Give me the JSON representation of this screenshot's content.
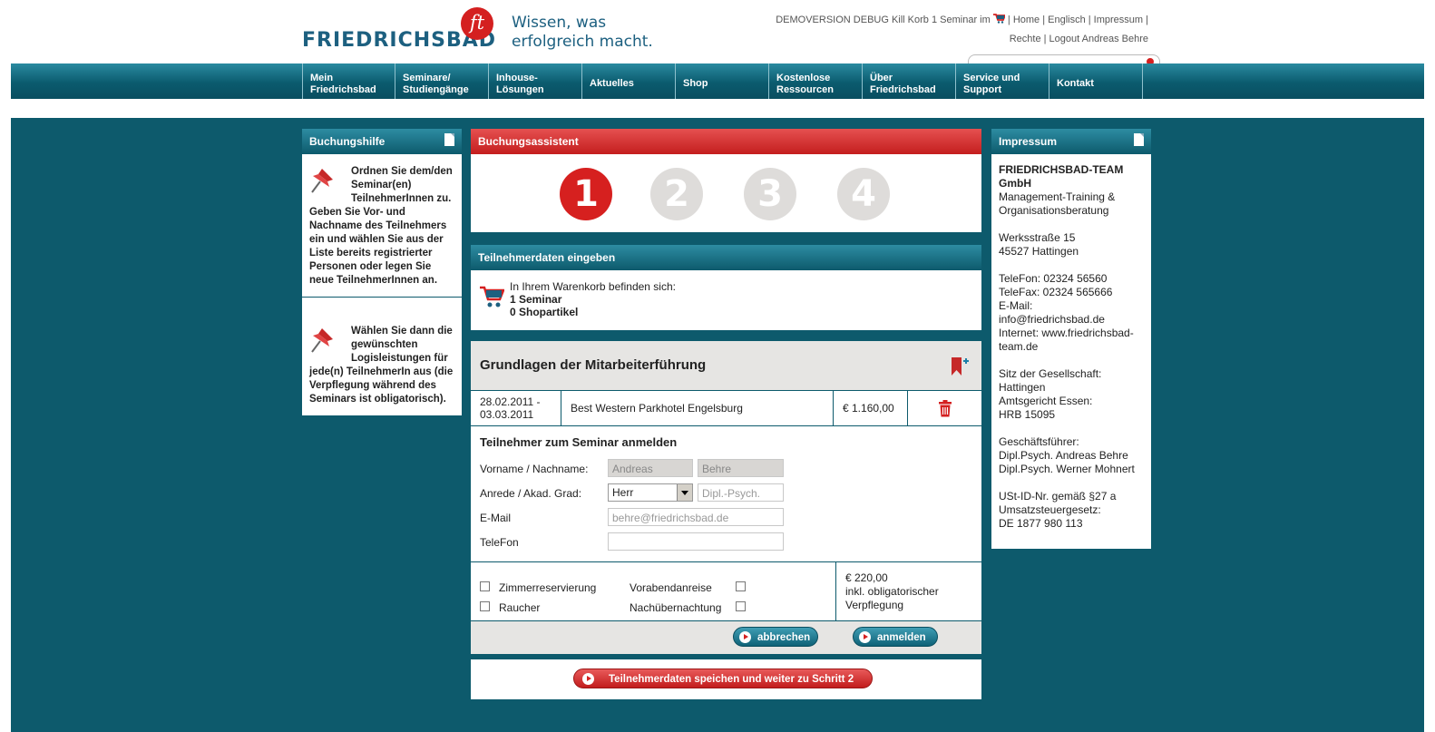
{
  "header": {
    "logo_text": "FRIEDRICHSBAD",
    "logo_mark": "ft",
    "slogan_line1": "Wissen, was",
    "slogan_line2": "erfolgreich macht.",
    "toplinks_line1_a": "DEMOVERSION DEBUG Kill Korb 1 Seminar im",
    "toplinks_line1_b": "| Home | Englisch | Impressum |",
    "toplinks_line2": "Rechte | Logout Andreas Behre",
    "cart_icon": "cart-icon"
  },
  "nav": {
    "items": [
      {
        "label": "Mein Friedrichsbad"
      },
      {
        "label": "Seminare/ Studiengänge"
      },
      {
        "label": "Inhouse-Lösungen"
      },
      {
        "label": "Aktuelles"
      },
      {
        "label": "Shop"
      },
      {
        "label": "Kostenlose Ressourcen"
      },
      {
        "label": "Über Friedrichsbad"
      },
      {
        "label": "Service und Support"
      },
      {
        "label": "Kontakt"
      }
    ]
  },
  "left": {
    "title": "Buchungshilfe",
    "help1": "Ordnen Sie dem/den Seminar(en) TeilnehmerInnen zu. Geben Sie Vor- und Nachname des Teilnehmers ein und wählen Sie aus der Liste bereits registrierter Personen oder legen Sie neue TeilnehmerInnen an.",
    "help2": "Wählen Sie dann die gewünschten Logisleistungen für jede(n) TeilnehmerIn aus (die Verpflegung während des Seminars ist obligatorisch)."
  },
  "wizard": {
    "title": "Buchungsassistent",
    "steps": [
      "1",
      "2",
      "3",
      "4"
    ],
    "active_step": 1,
    "participant_title": "Teilnehmerdaten eingeben",
    "cart_line1": "In Ihrem Warenkorb befinden sich:",
    "cart_line2": "1 Seminar",
    "cart_line3": "0 Shopartikel"
  },
  "seminar": {
    "title": "Grundlagen der Mitarbeiterführung",
    "date": "28.02.2011 - 03.03.2011",
    "hotel": "Best Western Parkhotel Engelsburg",
    "price": "€ 1.160,00"
  },
  "form": {
    "title": "Teilnehmer zum Seminar anmelden",
    "name_label": "Vorname / Nachname:",
    "firstname": "Andreas",
    "lastname": "Behre",
    "salutation_label": "Anrede / Akad. Grad:",
    "salutation": "Herr",
    "degree_placeholder": "Dipl.-Psych.",
    "email_label": "E-Mail",
    "email": "behre@friedrichsbad.de",
    "phone_label": "TeleFon",
    "phone": ""
  },
  "options": {
    "room": "Zimmerreservierung",
    "smoker": "Raucher",
    "arrival": "Vorabendanreise",
    "night": "Nachübernachtung",
    "price_line1": "€ 220,00",
    "price_line2": "inkl. obligatorischer",
    "price_line3": "Verpflegung"
  },
  "buttons": {
    "cancel": "abbrechen",
    "register": "anmelden",
    "save": "Teilnehmerdaten speichen und weiter zu Schritt 2"
  },
  "right": {
    "title": "Impressum",
    "company": "FRIEDRICHSBAD-TEAM GmbH",
    "company_sub1": "Management-Training &",
    "company_sub2": "Organisationsberatung",
    "street": "Werksstraße 15",
    "city": "45527 Hattingen",
    "phone": "TeleFon: 02324 56560",
    "fax": "TeleFax: 02324 565666",
    "email_label": "E-Mail:",
    "email": "info@friedrichsbad.de",
    "internet1": "Internet: www.friedrichsbad-",
    "internet2": "team.de",
    "seat1": "Sitz der Gesellschaft:",
    "seat2": "Hattingen",
    "court1": "Amtsgericht Essen:",
    "court2": "HRB 15095",
    "ceo_label": "Geschäftsführer:",
    "ceo1": "Dipl.Psych. Andreas Behre",
    "ceo2": "Dipl.Psych. Werner Mohnert",
    "vat1": "USt-ID-Nr. gemäß §27 a",
    "vat2": "Umsatzsteuergesetz:",
    "vat3": "DE 1877 980 113"
  },
  "colors": {
    "brand_teal": "#0d5a6c",
    "brand_red": "#d6201f"
  }
}
